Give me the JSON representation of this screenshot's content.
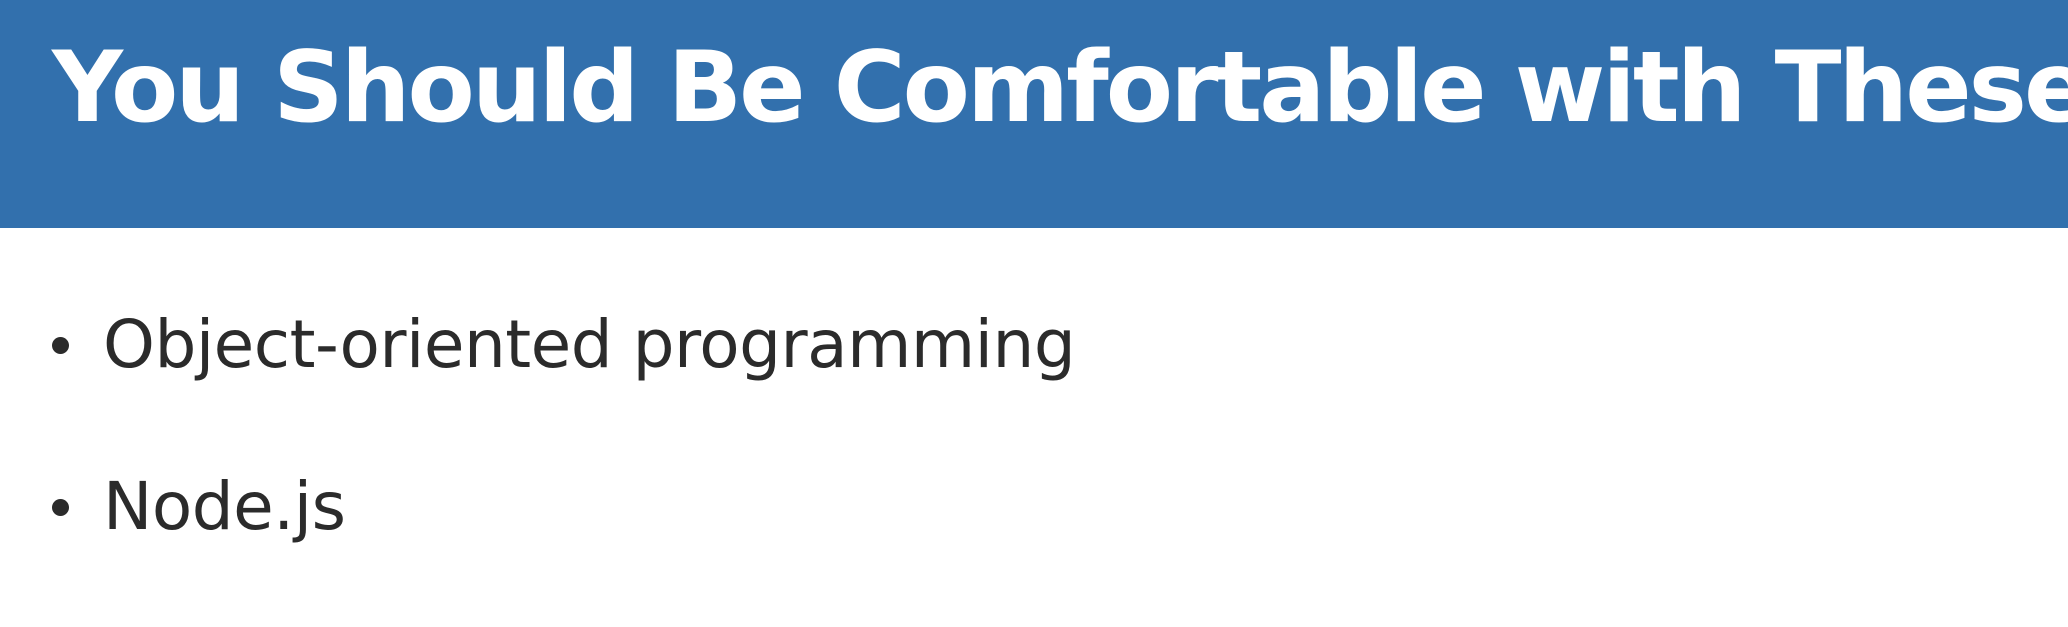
{
  "slide": {
    "title": "You Should Be Comfortable with These",
    "bullets": [
      {
        "label": "Object-oriented programming"
      },
      {
        "label": "Node.js"
      }
    ]
  },
  "colors": {
    "header_background": "#3270ad",
    "title_text": "#ffffff",
    "body_text": "#2b2b2b",
    "page_background": "#ffffff"
  }
}
